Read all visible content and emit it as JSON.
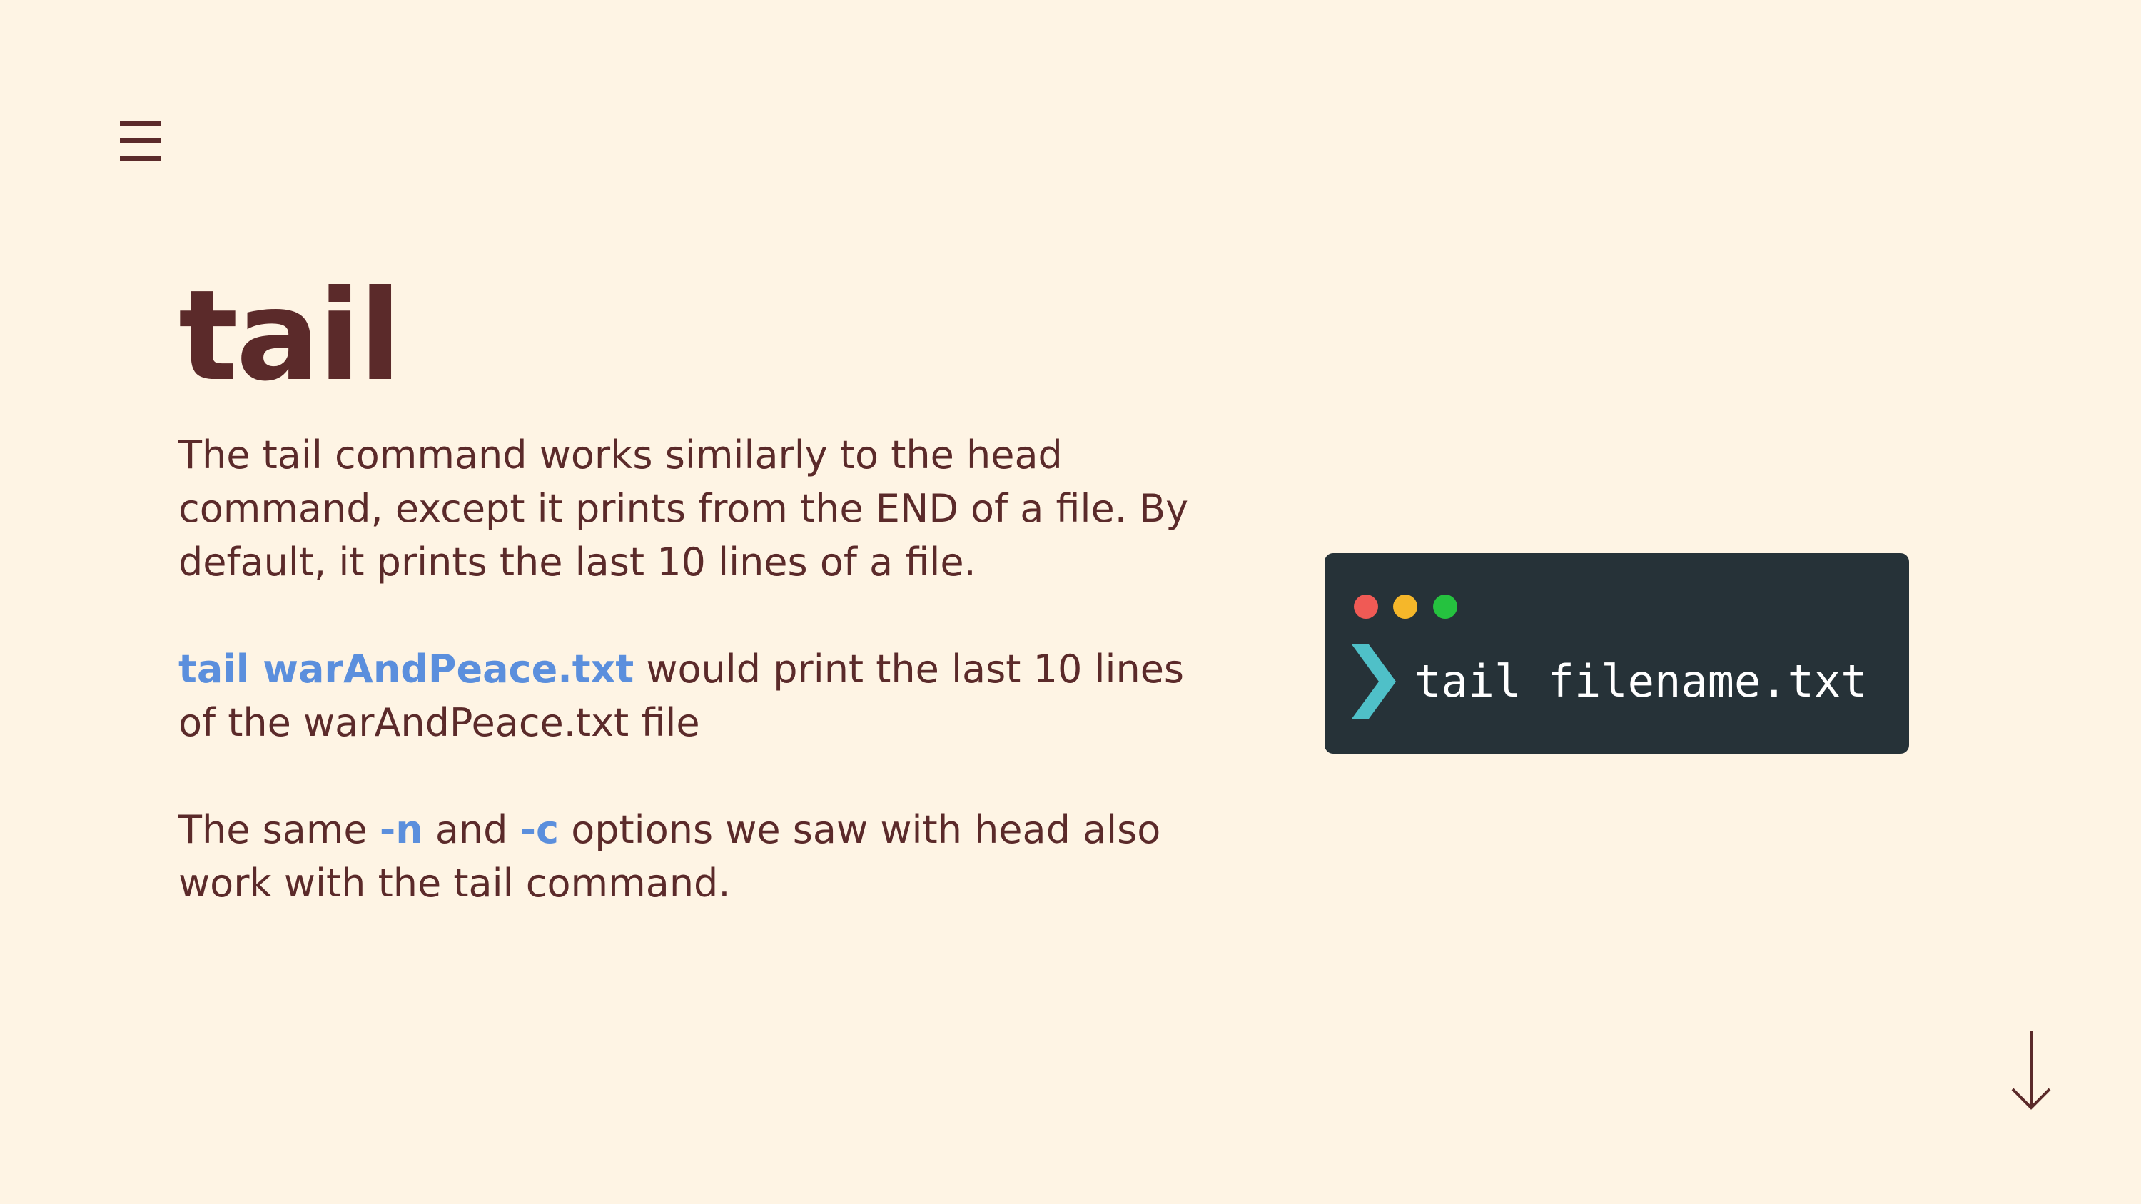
{
  "slide": {
    "title": "tail",
    "paragraph1": "The tail command works similarly to the head command, except it prints from the END of a file. By default, it prints the last 10 lines of a file.",
    "paragraph2": {
      "highlight": "tail warAndPeace.txt",
      "rest": " would print the last 10 lines of the warAndPeace.txt file"
    },
    "paragraph3": {
      "before": "The same ",
      "opt1": "-n",
      "middle": " and ",
      "opt2": "-c",
      "after": " options we saw with head also work with the tail command."
    }
  },
  "terminal": {
    "command": "tail filename.txt"
  },
  "colors": {
    "background": "#fef4e4",
    "text": "#5b2a2a",
    "accent": "#5b8fdd",
    "terminal_bg": "#263238",
    "prompt": "#4fc0c8"
  },
  "icons": {
    "menu": "hamburger-menu-icon",
    "prompt": "chevron-right-icon",
    "scroll": "arrow-down-icon"
  }
}
